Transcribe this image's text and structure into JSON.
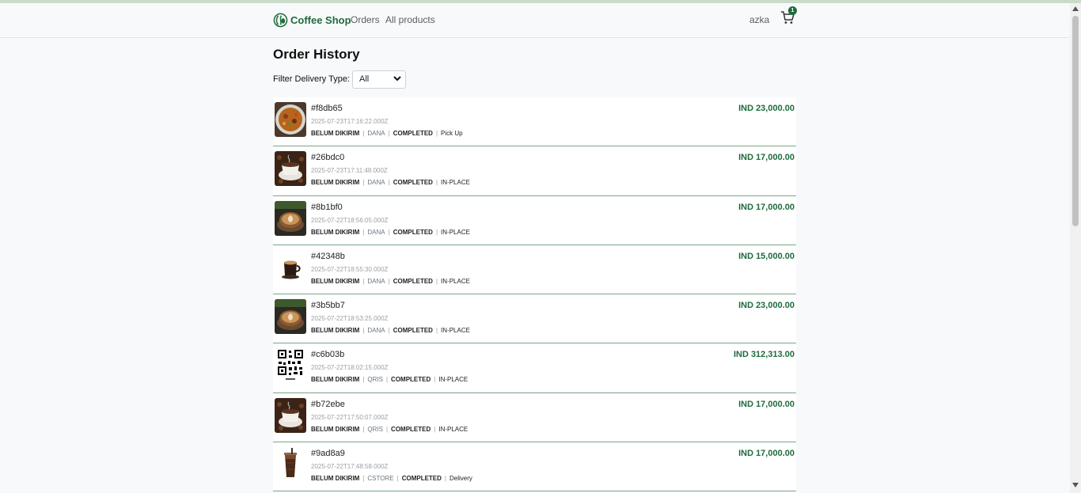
{
  "navbar": {
    "brand": "Coffee Shop",
    "links": [
      "Orders",
      "All products"
    ],
    "user": "azka",
    "cart_count": "1",
    "brand_icon": "coffee-logo-icon",
    "cart_icon": "cart-icon"
  },
  "page": {
    "title": "Order History",
    "filter_label": "Filter Delivery Type:",
    "filter_value": "All"
  },
  "orders": [
    {
      "id": "#f8db65",
      "date": "2025-07-23T17:16:22.000Z",
      "shipping": "BELUM DIKIRIM",
      "payment": "DANA",
      "status": "COMPLETED",
      "delivery": "Pick Up",
      "price": "IND 23,000.00",
      "image": "fried-rice"
    },
    {
      "id": "#26bdc0",
      "date": "2025-07-23T17:11:48.000Z",
      "shipping": "BELUM DIKIRIM",
      "payment": "DANA",
      "status": "COMPLETED",
      "delivery": "IN-PLACE",
      "price": "IND 17,000.00",
      "image": "coffee-beans-cup"
    },
    {
      "id": "#8b1bf0",
      "date": "2025-07-22T18:56:05.000Z",
      "shipping": "BELUM DIKIRIM",
      "payment": "DANA",
      "status": "COMPLETED",
      "delivery": "IN-PLACE",
      "price": "IND 17,000.00",
      "image": "latte"
    },
    {
      "id": "#42348b",
      "date": "2025-07-22T18:55:30.000Z",
      "shipping": "BELUM DIKIRIM",
      "payment": "DANA",
      "status": "COMPLETED",
      "delivery": "IN-PLACE",
      "price": "IND 15,000.00",
      "image": "espresso-cup"
    },
    {
      "id": "#3b5bb7",
      "date": "2025-07-22T18:53:25.000Z",
      "shipping": "BELUM DIKIRIM",
      "payment": "DANA",
      "status": "COMPLETED",
      "delivery": "IN-PLACE",
      "price": "IND 23,000.00",
      "image": "latte"
    },
    {
      "id": "#c6b03b",
      "date": "2025-07-22T18:02:15.000Z",
      "shipping": "BELUM DIKIRIM",
      "payment": "QRIS",
      "status": "COMPLETED",
      "delivery": "IN-PLACE",
      "price": "IND 312,313.00",
      "image": "qr-code"
    },
    {
      "id": "#b72ebe",
      "date": "2025-07-22T17:50:07.000Z",
      "shipping": "BELUM DIKIRIM",
      "payment": "QRIS",
      "status": "COMPLETED",
      "delivery": "IN-PLACE",
      "price": "IND 17,000.00",
      "image": "coffee-beans-cup"
    },
    {
      "id": "#9ad8a9",
      "date": "2025-07-22T17:48:58.000Z",
      "shipping": "BELUM DIKIRIM",
      "payment": "CSTORE",
      "status": "COMPLETED",
      "delivery": "Delivery",
      "price": "IND 17,000.00",
      "image": "iced-coffee"
    }
  ],
  "colors": {
    "brand": "#1e6b3c",
    "divider": "#7aa488",
    "muted": "#9aa0a6"
  }
}
